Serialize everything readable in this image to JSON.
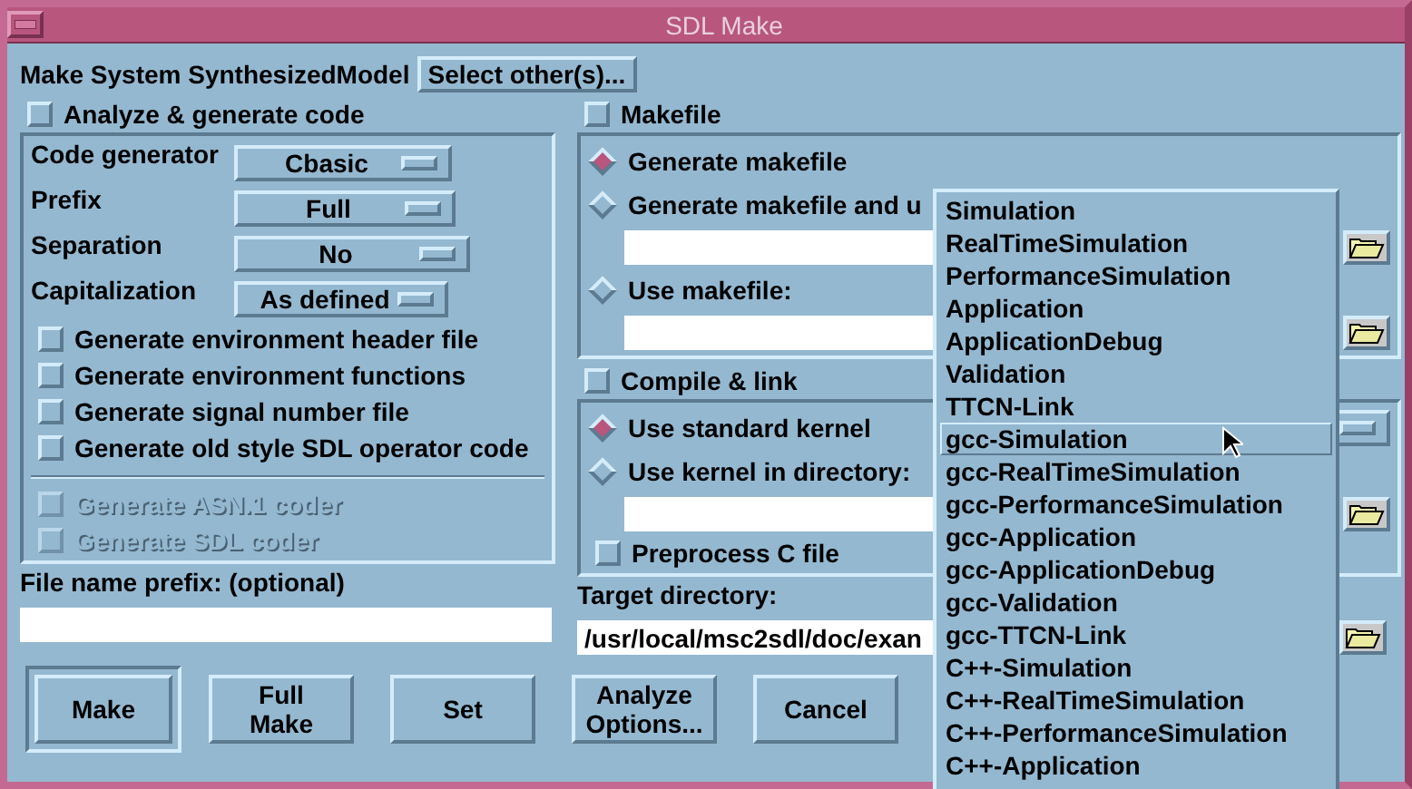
{
  "window": {
    "title": "SDL Make"
  },
  "make_system": {
    "label": "Make System SynthesizedModel",
    "button": "Select other(s)..."
  },
  "analyze": {
    "label": "Analyze & generate code",
    "checked": false,
    "settings": [
      {
        "label": "Code generator",
        "value": "Cbasic"
      },
      {
        "label": "Prefix",
        "value": "Full"
      },
      {
        "label": "Separation",
        "value": "No"
      },
      {
        "label": "Capitalization",
        "value": "As defined"
      }
    ],
    "options": [
      {
        "label": "Generate environment header file",
        "checked": false,
        "disabled": false
      },
      {
        "label": "Generate environment functions",
        "checked": false,
        "disabled": false
      },
      {
        "label": "Generate signal number file",
        "checked": false,
        "disabled": false
      },
      {
        "label": "Generate old style SDL operator code",
        "checked": false,
        "disabled": false
      }
    ],
    "coder_options": [
      {
        "label": "Generate ASN.1 coder",
        "checked": false,
        "disabled": true
      },
      {
        "label": "Generate SDL coder",
        "checked": false,
        "disabled": true
      }
    ]
  },
  "file_prefix": {
    "label": "File name prefix: (optional)"
  },
  "makefile": {
    "label": "Makefile",
    "checked": false,
    "rows": [
      {
        "kind": "radio",
        "label": "Generate makefile",
        "selected": true
      },
      {
        "kind": "radio",
        "label": "Generate makefile and u",
        "selected": false
      },
      {
        "kind": "path"
      },
      {
        "kind": "radio",
        "label": "Use makefile:",
        "selected": false
      },
      {
        "kind": "path"
      }
    ]
  },
  "compile": {
    "label": "Compile & link",
    "checked": false,
    "rows": [
      {
        "kind": "radio_menu",
        "label": "Use standard kernel",
        "selected": true
      },
      {
        "kind": "radio",
        "label": "Use kernel in directory:",
        "selected": false
      },
      {
        "kind": "path"
      },
      {
        "kind": "check",
        "label": "Preprocess C file",
        "checked": false
      }
    ]
  },
  "target": {
    "label": "Target directory:",
    "value": "/usr/local/msc2sdl/doc/exan"
  },
  "buttons": [
    {
      "label": "Make",
      "default": true
    },
    {
      "label": "Full\nMake",
      "default": false
    },
    {
      "label": "Set",
      "default": false
    },
    {
      "label": "Analyze\nOptions...",
      "default": false
    },
    {
      "label": "Cancel",
      "default": false
    }
  ],
  "popup": {
    "items": [
      {
        "label": "Simulation",
        "selected": false
      },
      {
        "label": "RealTimeSimulation",
        "selected": false
      },
      {
        "label": "PerformanceSimulation",
        "selected": false
      },
      {
        "label": "Application",
        "selected": false
      },
      {
        "label": "ApplicationDebug",
        "selected": false
      },
      {
        "label": "Validation",
        "selected": false
      },
      {
        "label": "TTCN-Link",
        "selected": false
      },
      {
        "label": "gcc-Simulation",
        "selected": true
      },
      {
        "label": "gcc-RealTimeSimulation",
        "selected": false
      },
      {
        "label": "gcc-PerformanceSimulation",
        "selected": false
      },
      {
        "label": "gcc-Application",
        "selected": false
      },
      {
        "label": "gcc-ApplicationDebug",
        "selected": false
      },
      {
        "label": "gcc-Validation",
        "selected": false
      },
      {
        "label": "gcc-TTCN-Link",
        "selected": false
      },
      {
        "label": "C++-Simulation",
        "selected": false
      },
      {
        "label": "C++-RealTimeSimulation",
        "selected": false
      },
      {
        "label": "C++-PerformanceSimulation",
        "selected": false
      },
      {
        "label": "C++-Application",
        "selected": false
      }
    ]
  }
}
